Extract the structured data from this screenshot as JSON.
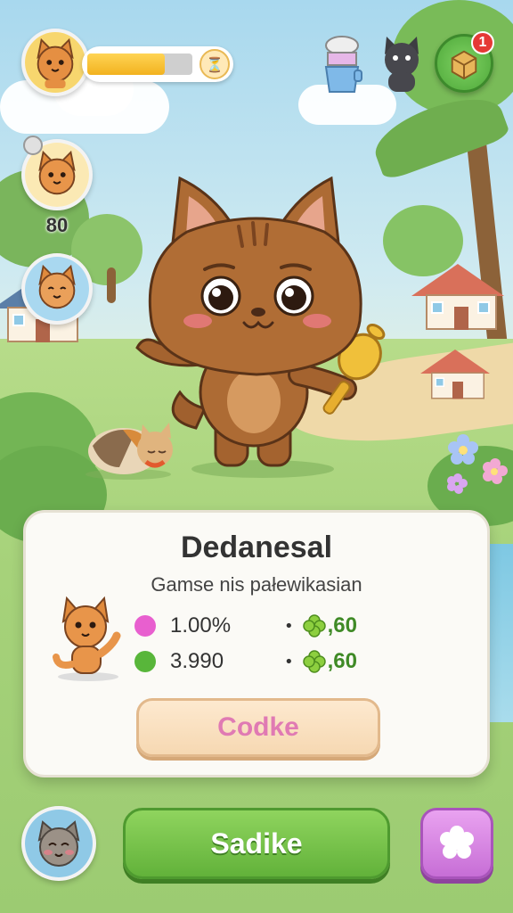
{
  "hud": {
    "energy_fraction": 0.74,
    "energy_icon": "hourglass-icon",
    "friend_count": "80",
    "notification_count": "1"
  },
  "card": {
    "title": "Dedanesal",
    "subtitle": "Gamse nis pałewikasian",
    "stats": [
      {
        "dot_color": "#e85fcf",
        "value": "1.00%",
        "reward": ",60"
      },
      {
        "dot_color": "#58b63a",
        "value": "3.990",
        "reward": ",60"
      }
    ],
    "button_label": "Codke"
  },
  "bottom": {
    "main_button_label": "Sadike",
    "side_button_icon": "flower-icon"
  },
  "colors": {
    "accent_green": "#62b23a",
    "accent_pink": "#e07ab3",
    "accent_purple": "#c76ed6",
    "energy_yellow": "#f2b21f"
  }
}
